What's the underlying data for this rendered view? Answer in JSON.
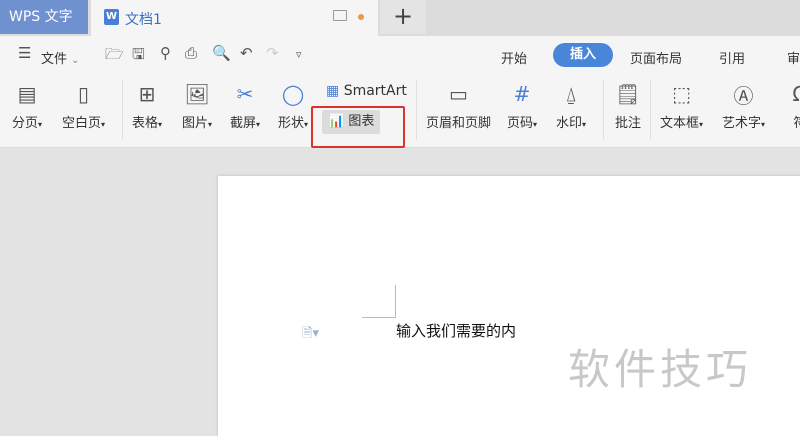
{
  "app_tab": "WPS 文字",
  "doc_tab": {
    "icon": "W",
    "title": "文档1"
  },
  "new_tab": "+",
  "file_menu": "文件",
  "menu_tabs": [
    "开始",
    "插入",
    "页面布局",
    "引用",
    "审"
  ],
  "tools": {
    "page_break": "分页",
    "blank_page": "空白页",
    "table": "表格",
    "picture": "图片",
    "screenshot": "截屏",
    "shape": "形状",
    "smartart": "SmartArt",
    "chart": "图表",
    "header_footer": "页眉和页脚",
    "page_num": "页码",
    "watermark": "水印",
    "comment": "批注",
    "textbox": "文本框",
    "wordart": "艺术字",
    "symbol": "符"
  },
  "document": {
    "text": "输入我们需要的内"
  },
  "watermark_text": "软件技巧",
  "colors": {
    "accent": "#4a86d8",
    "app_tab": "#6f91cf",
    "highlight": "#d9342b"
  }
}
